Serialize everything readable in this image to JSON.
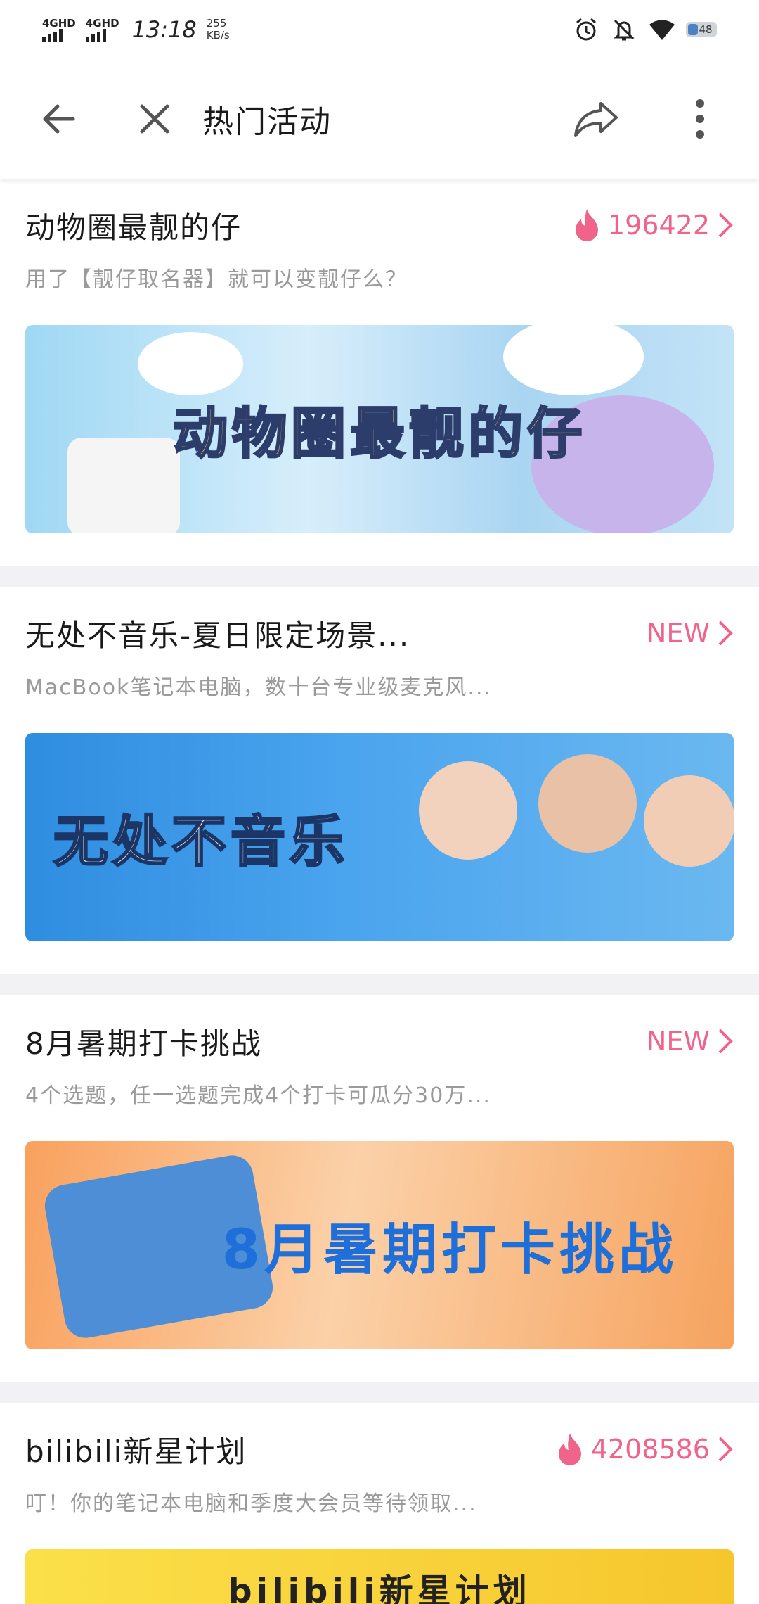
{
  "status_bar": {
    "network1": "4GHD",
    "network2": "4GHD",
    "time": "13:18",
    "speed_value": "255",
    "speed_unit": "KB/s",
    "battery": "48"
  },
  "toolbar": {
    "title": "热门活动"
  },
  "activities": [
    {
      "title": "动物圈最靓的仔",
      "tag": "196422",
      "tag_type": "hot",
      "desc": "用了【靓仔取名器】就可以变靓仔么？",
      "banner_text": "动物圈最靓的仔"
    },
    {
      "title": "无处不音乐-夏日限定场景...",
      "tag": "NEW",
      "tag_type": "new",
      "desc": "MacBook笔记本电脑，数十台专业级麦克风...",
      "banner_text": "无处不音乐"
    },
    {
      "title": "8月暑期打卡挑战",
      "tag": "NEW",
      "tag_type": "new",
      "desc": "4个选题，任一选题完成4个打卡可瓜分30万...",
      "banner_text": "8月暑期打卡挑战"
    },
    {
      "title": "bilibili新星计划",
      "tag": "4208586",
      "tag_type": "hot",
      "desc": "叮！你的笔记本电脑和季度大会员等待领取...",
      "banner_text": "bilibili新星计划"
    }
  ],
  "colors": {
    "accent": "#f0648c",
    "divider": "#f2f2f4",
    "desc_text": "#9a9a9a"
  }
}
